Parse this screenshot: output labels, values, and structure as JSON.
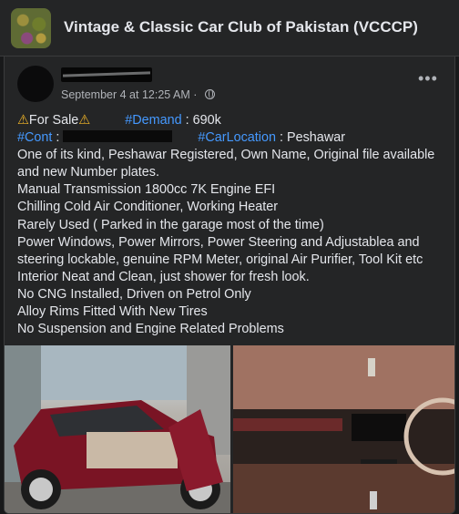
{
  "group": {
    "title": "Vintage & Classic Car Club of Pakistan (VCCCP)"
  },
  "post": {
    "timestamp": "September 4 at 12:25 AM · ",
    "more_label": "•••",
    "for_sale": "For Sale",
    "demand_tag": "#Demand",
    "demand_value": " : 690k",
    "cont_tag": "#Cont",
    "cont_sep": " : ",
    "location_tag": "#CarLocation",
    "location_value": " : Peshawar",
    "lines": [
      "One of its kind, Peshawar Registered, Own Name, Original file available",
      "and new Number plates.",
      "Manual Transmission 1800cc 7K Engine EFI",
      "Chilling Cold Air Conditioner, Working Heater",
      "Rarely Used ( Parked in the garage most of the time)",
      "Power Windows, Power Mirrors, Power Steering and Adjustablea and",
      "steering lockable, genuine RPM Meter, original Air Purifier, Tool Kit etc",
      "Interior Neat and Clean, just shower for fresh look.",
      "No CNG Installed, Driven on Petrol Only",
      "Alloy Rims Fitted With New Tires",
      "No Suspension and Engine Related Problems"
    ]
  },
  "icons": {
    "warning": "warning-icon",
    "globe": "globe-icon",
    "more": "more-icon"
  },
  "colors": {
    "background": "#18191a",
    "card": "#242526",
    "text": "#e4e6eb",
    "secondary_text": "#b0b3b8",
    "hashtag": "#4599ff",
    "car_paint": "#7a1424"
  }
}
